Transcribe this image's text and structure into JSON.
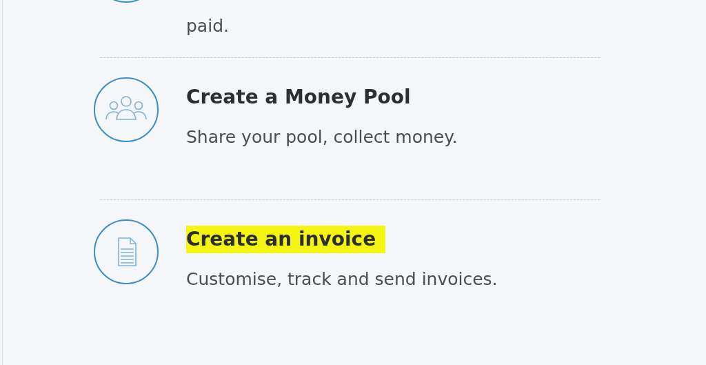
{
  "items": [
    {
      "description": "paid."
    },
    {
      "title": "Create a Money Pool",
      "highlighted": false,
      "description": "Share your pool, collect money."
    },
    {
      "title": "Create an invoice",
      "highlighted": true,
      "description": "Customise, track and send invoices."
    }
  ]
}
